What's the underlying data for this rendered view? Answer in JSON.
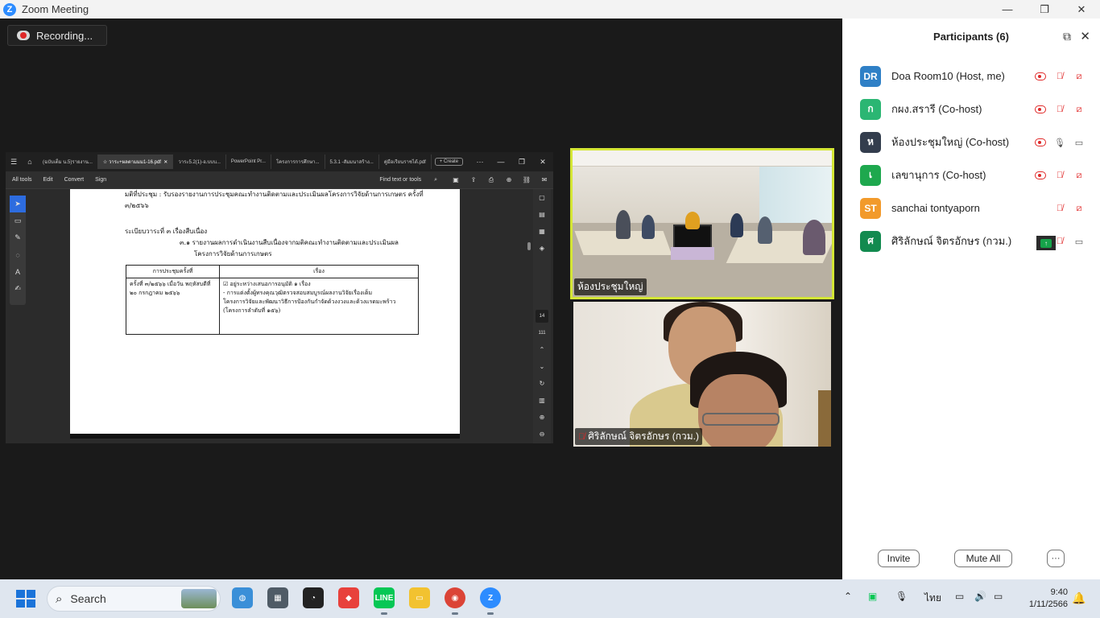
{
  "window": {
    "title": "Zoom Meeting",
    "minimize": "—",
    "restore": "❐",
    "close": "✕"
  },
  "recording": {
    "label": "Recording..."
  },
  "shared_screen": {
    "tabs": [
      "(ฉบับเต็ม น.5)รายงาน...",
      "วาระ+ผลตามมม1-16.pdf",
      "วาระ5.2(1)-อ.บบบ...",
      "PowerPoint Pr...",
      "โครงการการศึกษา...",
      "5.3.1 -สัมมนาสร้าง...",
      "คู่มือเรียนราชได้.pdf"
    ],
    "create_label": "Create",
    "menu": [
      "All tools",
      "Edit",
      "Convert",
      "Sign"
    ],
    "find_label": "Find text or tools",
    "page_number": "14",
    "page_total": "111",
    "doc": {
      "line1": "มติที่ประชุม : รับรองรายงานการประชุมคณะทำงานติดตามและประเมินผลโครงการวิจัยด้านการเกษตร ครั้งที่",
      "line2": "๓/๒๕๖๖",
      "line3": "ระเบียบวาระที่ ๓  เรื่องสืบเนื่อง",
      "line4": "๓.๑ รายงานผลการดำเนินงานสืบเนื่องจากมติคณะทำงานติดตามและประเมินผล",
      "line5": "โครงการวิจัยด้านการเกษตร",
      "table_head_1": "การประชุมครั้งที่",
      "table_head_2": "เรื่อง",
      "cell_1": "ครั้งที่ ๓/๒๕๖๖ เมื่อวัน พฤหัสบดีที่ ๒๐ กรกฎาคม ๒๕๖๖",
      "cell_2a": "☑ อยู่ระหว่างเสนอการอนุมัติ ๑ เรื่อง",
      "cell_2b": "- การแต่งตั้งผู้ทรงคุณวุฒิตรวจสอบสมบูรณ์ผลงานวิจัยเรื่องเด็ม",
      "cell_2c": "โครงการวิจัยและพัฒนาวิธีการป้องกันกำจัดด้วงงวงและด้วงแรดมะพร้าว",
      "cell_2d": "(โครงการลำดับที่ ๑๕๖)"
    }
  },
  "videos": [
    {
      "name": "ห้องประชุมใหญ่",
      "active_speaker": true
    },
    {
      "name": "ศิริลักษณ์  จิตรอักษร (กวม.)",
      "muted": true
    }
  ],
  "participants_panel": {
    "title": "Participants (6)",
    "participants": [
      {
        "initials": "DR",
        "name": "Doa Room10 (Host, me)",
        "color": "#2f80c6",
        "sharing": false,
        "recording": true,
        "mic": "muted",
        "video": "off"
      },
      {
        "initials": "ก",
        "name": "กผง.สรารี (Co-host)",
        "color": "#2bb673",
        "sharing": true,
        "recording": true,
        "mic": "muted",
        "video": "off"
      },
      {
        "initials": "ห",
        "name": "ห้องประชุมใหญ่ (Co-host)",
        "color": "#333d4d",
        "sharing": false,
        "recording": true,
        "mic": "on",
        "video": "on"
      },
      {
        "initials": "เ",
        "name": "เลขานุการ (Co-host)",
        "color": "#1ea84e",
        "sharing": false,
        "recording": true,
        "mic": "muted",
        "video": "off"
      },
      {
        "initials": "ST",
        "name": "sanchai tontyaporn",
        "color": "#f29a2b",
        "sharing": false,
        "recording": false,
        "mic": "muted",
        "video": "off"
      },
      {
        "initials": "ศ",
        "name": "ศิริลักษณ์  จิตรอักษร (กวม.)",
        "color": "#128a4f",
        "sharing": false,
        "recording": false,
        "mic": "muted",
        "video": "on"
      }
    ],
    "invite_label": "Invite",
    "mute_all_label": "Mute All",
    "more_label": "···"
  },
  "taskbar": {
    "search_label": "Search",
    "language": "ไทย",
    "time": "9:40",
    "date": "1/11/2566",
    "colors": {
      "maps": "#3a8fd8",
      "calculator": "#4f5b66",
      "speedtest": "#222222",
      "anydesk": "#e8413c",
      "line": "#06c755",
      "files": "#f2c230",
      "chrome": "#db4437",
      "zoom": "#2d8cff"
    }
  }
}
